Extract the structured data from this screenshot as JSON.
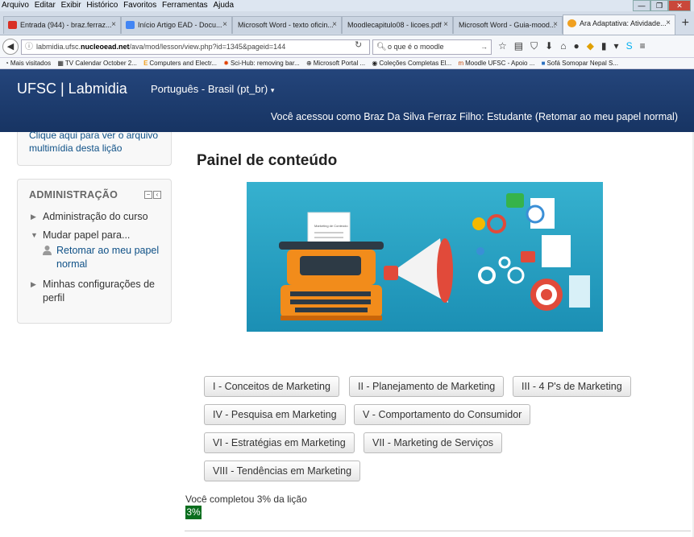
{
  "browser": {
    "menu": [
      "Arquivo",
      "Editar",
      "Exibir",
      "Histórico",
      "Favoritos",
      "Ferramentas",
      "Ajuda"
    ],
    "tabs": [
      {
        "label": "Entrada (944) - braz.ferraz...",
        "color": "#d93025"
      },
      {
        "label": "Início Artigo EAD - Docu...",
        "color": "#4285f4"
      },
      {
        "label": "Microsoft Word - texto oficin...",
        "color": ""
      },
      {
        "label": "Moodlecapitulo08 - licoes.pdf",
        "color": ""
      },
      {
        "label": "Microsoft Word - Guia-mood...",
        "color": ""
      },
      {
        "label": "Ara Adaptativa: Atividade...",
        "color": "#f0a020"
      }
    ],
    "url_prefix": "labmidia.ufsc.",
    "url_domain": "nucleoead.net",
    "url_path": "/ava/mod/lesson/view.php?id=1345&pageid=144",
    "search_value": "o que é o moodle",
    "bookmarks": [
      "Mais visitados",
      "TV Calendar October 2...",
      "Computers and Electr...",
      "Sci-Hub: removing bar...",
      "Microsoft Portal ...",
      "Coleções Completas El...",
      "Moodle UFSC - Apoio ...",
      "Sofá Somopar Nepal S..."
    ]
  },
  "header": {
    "brand": "UFSC | Labmidia",
    "language": "Português - Brasil (pt_br)",
    "login_info": "Você acessou como Braz Da Silva Ferraz Filho: Estudante (Retomar ao meu papel normal)"
  },
  "sidebar": {
    "media_link": "Clique aqui para ver o arquivo multimídia desta lição",
    "admin_title": "ADMINISTRAÇÃO",
    "items": {
      "course_admin": "Administração do curso",
      "switch_role": "Mudar papel para...",
      "return_role": "Retomar ao meu papel normal",
      "profile_settings": "Minhas configurações de perfil"
    }
  },
  "main": {
    "title": "Painel de conteúdo",
    "hero_label": "Marketing de Conteúdo",
    "buttons": [
      "I - Conceitos de Marketing",
      "II - Planejamento de Marketing",
      "III - 4 P's de Marketing",
      "IV - Pesquisa em Marketing",
      "V - Comportamento do Consumidor",
      "VI - Estratégias em Marketing",
      "VII - Marketing de Serviços",
      "VIII - Tendências em Marketing"
    ],
    "progress_text": "Você completou 3% da lição",
    "progress_label": "3%",
    "progress_value": 3
  }
}
